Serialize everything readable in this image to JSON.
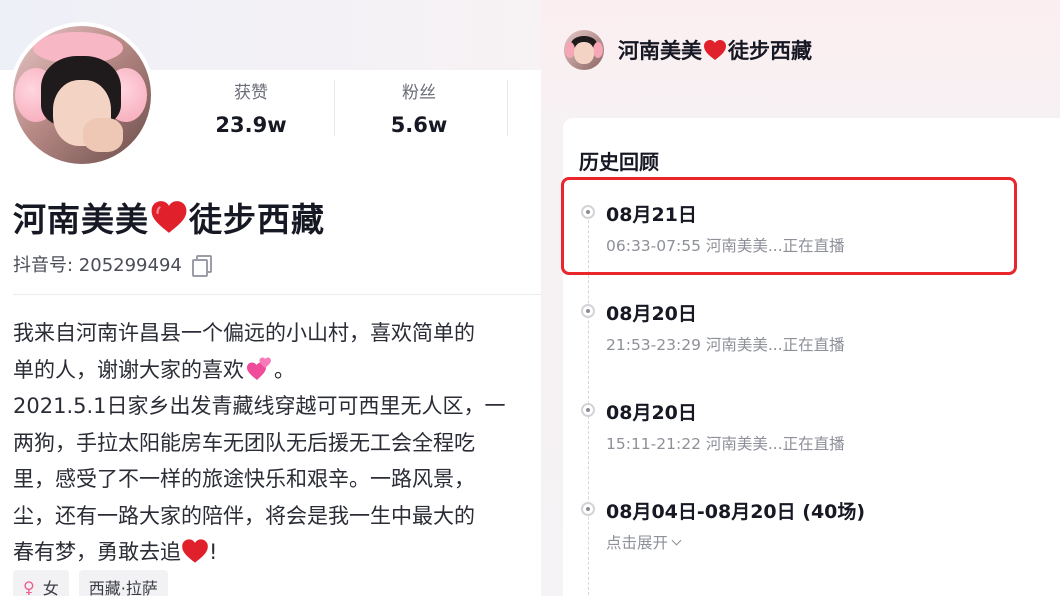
{
  "profile": {
    "stats": [
      {
        "label": "获赞",
        "value": "23.9w"
      },
      {
        "label": "粉丝",
        "value": "5.6w"
      }
    ],
    "name_part1": "河南美美",
    "name_part2": "徒步西藏",
    "douyin_id": "抖音号: 205299494",
    "bio_lines": [
      "我来自河南许昌县一个偏远的小山村，喜欢简单的",
      "单的人，谢谢大家的喜欢",
      "2021.5.1日家乡出发青藏线穿越可可西里无人区，一",
      "两狗，手拉太阳能房车无团队无后援无工会全程吃",
      "里，感受了不一样的旅途快乐和艰辛。一路风景，",
      "尘，还有一路大家的陪伴，将会是我一生中最大的",
      "春有梦，勇敢去追"
    ],
    "bio_line2_tail": "。",
    "bio_line7_tail": "!",
    "tags": {
      "gender": "女",
      "location": "西藏·拉萨"
    }
  },
  "live_history": {
    "header_name_part1": "河南美美",
    "header_name_part2": "徒步西藏",
    "section_title": "历史回顾",
    "entries": [
      {
        "date": "08月21日",
        "detail": "06:33-07:55  河南美美...正在直播"
      },
      {
        "date": "08月20日",
        "detail": "21:53-23:29  河南美美...正在直播"
      },
      {
        "date": "08月20日",
        "detail": "15:11-21:22  河南美美...正在直播"
      },
      {
        "date": "08月04日-08月20日 (40场)",
        "expand_label": "点击展开"
      }
    ]
  },
  "colors": {
    "highlight": "#e8262c",
    "heart": "#e0202b",
    "sparkle_heart": "#f04a9a"
  },
  "icons": [
    "heart-icon",
    "copy-icon",
    "female-icon",
    "chevron-down-icon",
    "sparkle-heart-icon"
  ]
}
